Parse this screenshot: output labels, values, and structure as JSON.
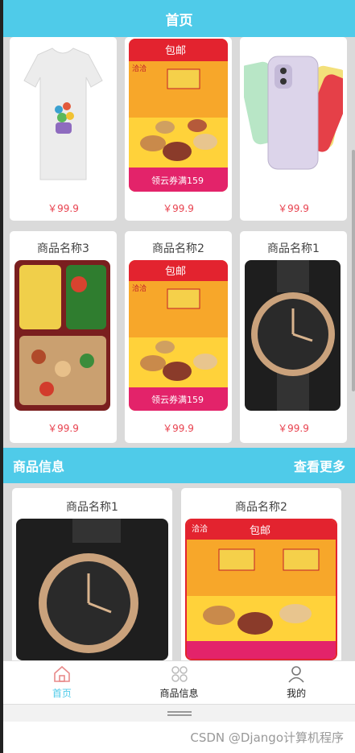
{
  "header": {
    "title": "首页"
  },
  "grid": {
    "row1": [
      {
        "name": "",
        "price": "￥99.9",
        "image": "t-shirt"
      },
      {
        "name": "",
        "price": "￥99.9",
        "image": "snack-box"
      },
      {
        "name": "",
        "price": "￥99.9",
        "image": "phones"
      }
    ],
    "row2": [
      {
        "name": "商品名称3",
        "price": "￥99.9",
        "image": "bento"
      },
      {
        "name": "商品名称2",
        "price": "￥99.9",
        "image": "snack-box"
      },
      {
        "name": "商品名称1",
        "price": "￥99.9",
        "image": "watch"
      }
    ]
  },
  "snack_labels": {
    "badge": "包邮",
    "brand": "洽洽",
    "coupon": "领云券满159"
  },
  "section": {
    "title": "商品信息",
    "more": "查看更多"
  },
  "info": [
    {
      "name": "商品名称1",
      "image": "watch"
    },
    {
      "name": "商品名称2",
      "image": "snack-box"
    }
  ],
  "tabbar": [
    {
      "label": "首页",
      "icon": "home-icon",
      "active": true
    },
    {
      "label": "商品信息",
      "icon": "grid-icon",
      "active": false
    },
    {
      "label": "我的",
      "icon": "user-icon",
      "active": false
    }
  ],
  "watermark": "CSDN @Django计算机程序",
  "colors": {
    "accent": "#4fcbe9",
    "price": "#e8414e"
  }
}
